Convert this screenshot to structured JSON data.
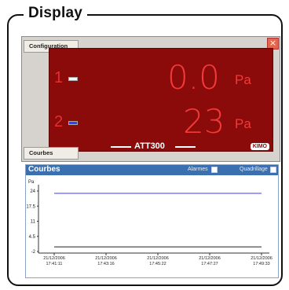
{
  "frame": {
    "title": "Display"
  },
  "window": {
    "close_glyph": "×",
    "tab_top": "Configuration",
    "tab_bottom": "Courbes"
  },
  "display": {
    "channels": [
      {
        "number": "1",
        "value": "0.0",
        "unit": "Pa",
        "marker_color": "#f5f5f5"
      },
      {
        "number": "2",
        "value": "23",
        "unit": "Pa",
        "marker_color": "#3b3bff"
      }
    ],
    "device_name": "ATT300",
    "logo_text": "KIMO",
    "colors": {
      "background": "#8b0a0a",
      "digits": "#f23a3a"
    }
  },
  "chart_panel": {
    "title": "Courbes",
    "alarmes_label": "Alarmes",
    "quadrillage_label": "Quadrillage",
    "header_color": "#3a6fb0"
  },
  "chart_data": {
    "type": "line",
    "ylabel": "Pa",
    "yticks": [
      "24",
      "17.5",
      "11",
      "4.5",
      "-2"
    ],
    "ylim": [
      -2,
      24
    ],
    "x": [
      "21/12/2006 17:41:11",
      "21/12/2006 17:43:16",
      "21/12/2006 17:45:22",
      "21/12/2006 17:47:27",
      "21/12/2006 17:49:33"
    ],
    "xtick_dates": [
      "21/12/2006",
      "21/12/2006",
      "21/12/2006",
      "21/12/2006",
      "21/12/2006"
    ],
    "xtick_times": [
      "17:41:11",
      "17:43:16",
      "17:45:22",
      "17:47:27",
      "17:49:33"
    ],
    "series": [
      {
        "values": [
          23,
          23,
          23,
          23,
          23
        ],
        "color": "#3b3bff"
      },
      {
        "values": [
          0,
          0,
          0,
          0,
          0
        ],
        "color": "#222222"
      }
    ]
  }
}
